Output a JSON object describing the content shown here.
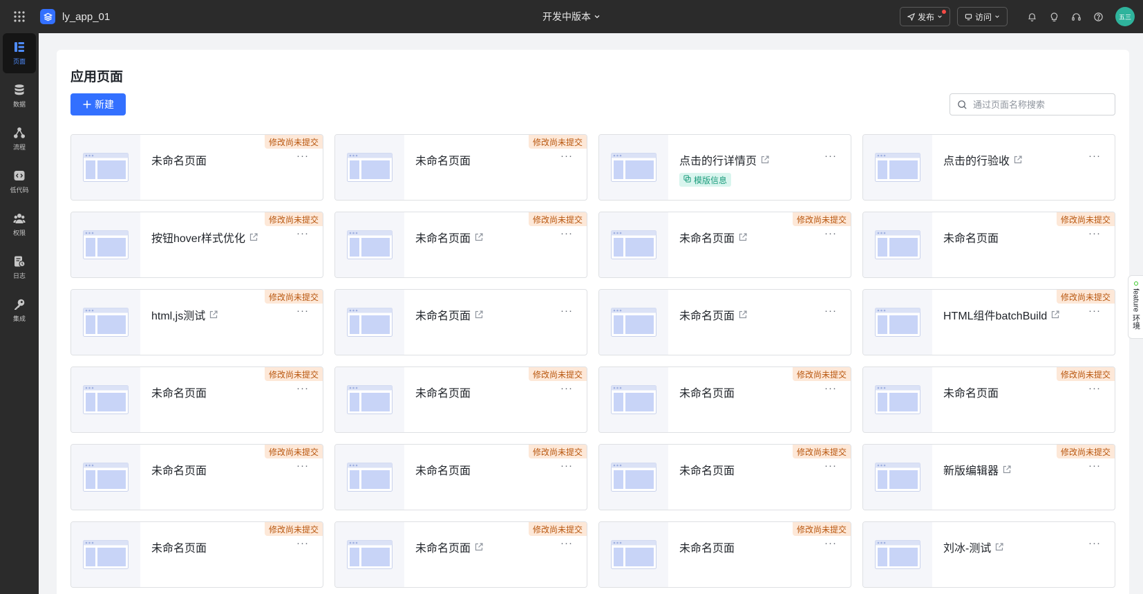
{
  "topbar": {
    "app_name": "ly_app_01",
    "version_label": "开发中版本",
    "publish_label": "发布",
    "visit_label": "访问",
    "avatar_text": "五三"
  },
  "sidebar": {
    "items": [
      {
        "label": "页面",
        "icon": "page-icon"
      },
      {
        "label": "数据",
        "icon": "database-icon"
      },
      {
        "label": "流程",
        "icon": "flow-icon"
      },
      {
        "label": "低代码",
        "icon": "code-icon"
      },
      {
        "label": "权限",
        "icon": "users-icon"
      },
      {
        "label": "日志",
        "icon": "log-icon"
      },
      {
        "label": "集成",
        "icon": "key-icon"
      }
    ]
  },
  "main": {
    "title": "应用页面",
    "new_label": "新建",
    "search_placeholder": "通过页面名称搜索"
  },
  "cards": [
    {
      "name": "未命名页面",
      "external": false,
      "badge": "修改尚未提交",
      "tag": ""
    },
    {
      "name": "未命名页面",
      "external": false,
      "badge": "修改尚未提交",
      "tag": ""
    },
    {
      "name": "点击的行详情页",
      "external": true,
      "badge": "",
      "tag": "模版信息"
    },
    {
      "name": "点击的行验收",
      "external": true,
      "badge": "",
      "tag": ""
    },
    {
      "name": "按钮hover样式优化",
      "external": true,
      "badge": "修改尚未提交",
      "tag": ""
    },
    {
      "name": "未命名页面",
      "external": true,
      "badge": "修改尚未提交",
      "tag": ""
    },
    {
      "name": "未命名页面",
      "external": true,
      "badge": "修改尚未提交",
      "tag": ""
    },
    {
      "name": "未命名页面",
      "external": false,
      "badge": "修改尚未提交",
      "tag": ""
    },
    {
      "name": "html,js测试",
      "external": true,
      "badge": "修改尚未提交",
      "tag": ""
    },
    {
      "name": "未命名页面",
      "external": true,
      "badge": "",
      "tag": ""
    },
    {
      "name": "未命名页面",
      "external": true,
      "badge": "",
      "tag": ""
    },
    {
      "name": "HTML组件batchBuild",
      "external": true,
      "badge": "修改尚未提交",
      "tag": ""
    },
    {
      "name": "未命名页面",
      "external": false,
      "badge": "修改尚未提交",
      "tag": ""
    },
    {
      "name": "未命名页面",
      "external": false,
      "badge": "修改尚未提交",
      "tag": ""
    },
    {
      "name": "未命名页面",
      "external": false,
      "badge": "修改尚未提交",
      "tag": ""
    },
    {
      "name": "未命名页面",
      "external": false,
      "badge": "修改尚未提交",
      "tag": ""
    },
    {
      "name": "未命名页面",
      "external": false,
      "badge": "修改尚未提交",
      "tag": ""
    },
    {
      "name": "未命名页面",
      "external": false,
      "badge": "修改尚未提交",
      "tag": ""
    },
    {
      "name": "未命名页面",
      "external": false,
      "badge": "修改尚未提交",
      "tag": ""
    },
    {
      "name": "新版编辑器",
      "external": true,
      "badge": "修改尚未提交",
      "tag": ""
    },
    {
      "name": "未命名页面",
      "external": false,
      "badge": "修改尚未提交",
      "tag": ""
    },
    {
      "name": "未命名页面",
      "external": true,
      "badge": "修改尚未提交",
      "tag": ""
    },
    {
      "name": "未命名页面",
      "external": false,
      "badge": "修改尚未提交",
      "tag": ""
    },
    {
      "name": "刘冰-测试",
      "external": true,
      "badge": "",
      "tag": ""
    }
  ],
  "feature_tab": {
    "label": "feature 环境"
  },
  "colors": {
    "accent": "#3370ff",
    "badge_bg": "#fde8d8",
    "badge_text": "#b9570f",
    "tag_bg": "#d9f5ee",
    "tag_text": "#1b9c7c"
  }
}
